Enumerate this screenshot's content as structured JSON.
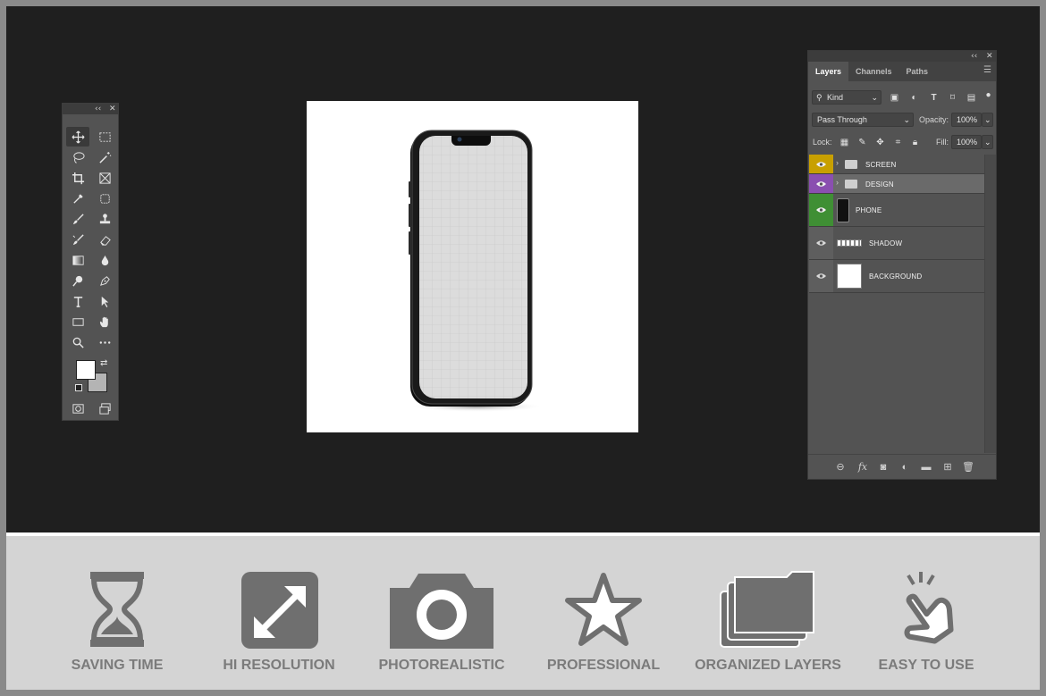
{
  "layers_panel": {
    "tabs": [
      "Layers",
      "Channels",
      "Paths"
    ],
    "filter_kind": "Kind",
    "blend_mode": "Pass Through",
    "opacity_label": "Opacity:",
    "opacity_value": "100%",
    "lock_label": "Lock:",
    "fill_label": "Fill:",
    "fill_value": "100%",
    "layers": [
      {
        "name": "SCREEN",
        "type": "group",
        "color": "#c8a000"
      },
      {
        "name": "DESIGN",
        "type": "group",
        "color": "#8a4fb0"
      },
      {
        "name": "PHONE",
        "type": "layer",
        "color": "#3f8f34"
      },
      {
        "name": "SHADOW",
        "type": "layer",
        "color": ""
      },
      {
        "name": "BACKGROUND",
        "type": "layer",
        "color": ""
      }
    ]
  },
  "toolbox": {
    "tools": [
      "move-icon",
      "marquee-icon",
      "lasso-icon",
      "magic-wand-icon",
      "crop-icon",
      "frame-icon",
      "eyedropper-icon",
      "patch-icon",
      "brush-icon",
      "stamp-icon",
      "history-brush-icon",
      "eraser-icon",
      "gradient-icon",
      "drop-icon",
      "dodge-icon",
      "pen-icon",
      "type-icon",
      "path-select-icon",
      "rectangle-icon",
      "hand-icon",
      "zoom-icon",
      "more-icon"
    ],
    "foreground_color": "#ffffff",
    "background_color": "#b4b4b4"
  },
  "features": [
    {
      "label": "SAVING TIME",
      "icon": "hourglass-icon"
    },
    {
      "label": "HI RESOLUTION",
      "icon": "expand-icon"
    },
    {
      "label": "PHOTOREALISTIC",
      "icon": "camera-icon"
    },
    {
      "label": "PROFESSIONAL",
      "icon": "star-icon"
    },
    {
      "label": "ORGANIZED LAYERS",
      "icon": "folders-icon"
    },
    {
      "label": "EASY TO USE",
      "icon": "tap-hand-icon"
    }
  ]
}
